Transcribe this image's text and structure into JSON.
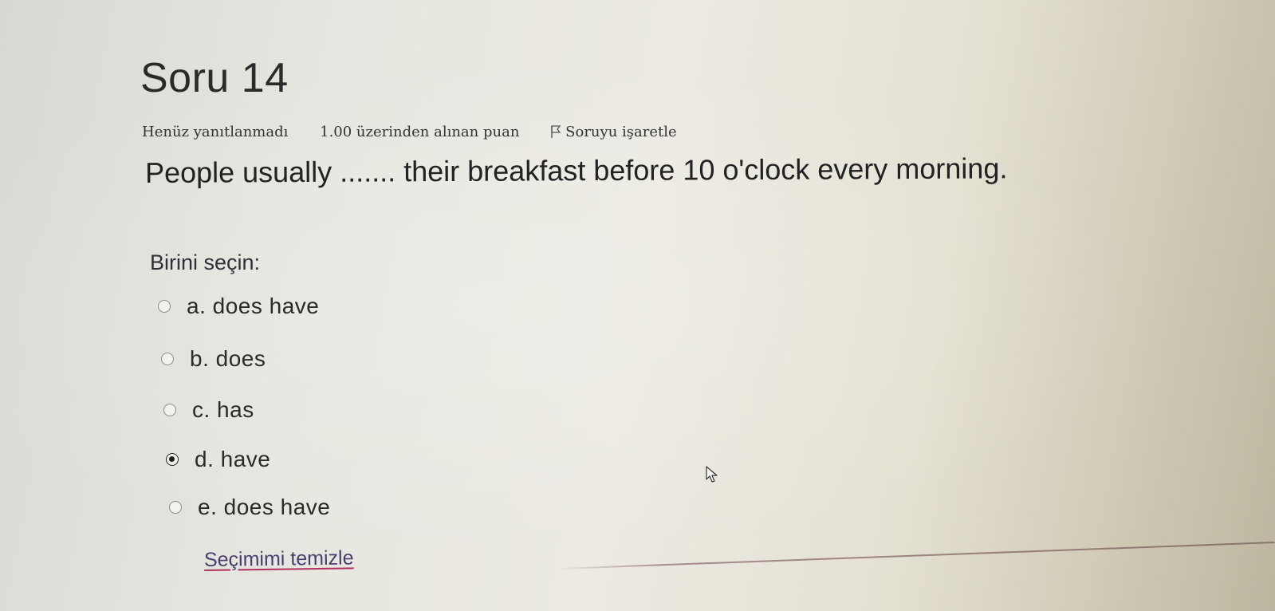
{
  "question": {
    "title": "Soru 14",
    "status": "Henüz yanıtlanmadı",
    "grade": "1.00 üzerinden alınan puan",
    "flag_label": "Soruyu işaretle",
    "text": "People usually ....... their breakfast before 10 o'clock every morning."
  },
  "answer": {
    "prompt": "Birini seçin:",
    "options": [
      {
        "label": "a. does have",
        "selected": false
      },
      {
        "label": "b. does",
        "selected": false
      },
      {
        "label": "c. has",
        "selected": false
      },
      {
        "label": "d. have",
        "selected": true
      },
      {
        "label": "e. does have",
        "selected": false
      }
    ],
    "clear_label": "Seçimimi temizle"
  },
  "icons": {
    "flag": "flag-icon",
    "radio": "radio-icon",
    "cursor": "mouse-pointer-icon"
  },
  "colors": {
    "link": "#4a3e6e",
    "link_underline": "#b03060",
    "text": "#2a2a2a"
  }
}
